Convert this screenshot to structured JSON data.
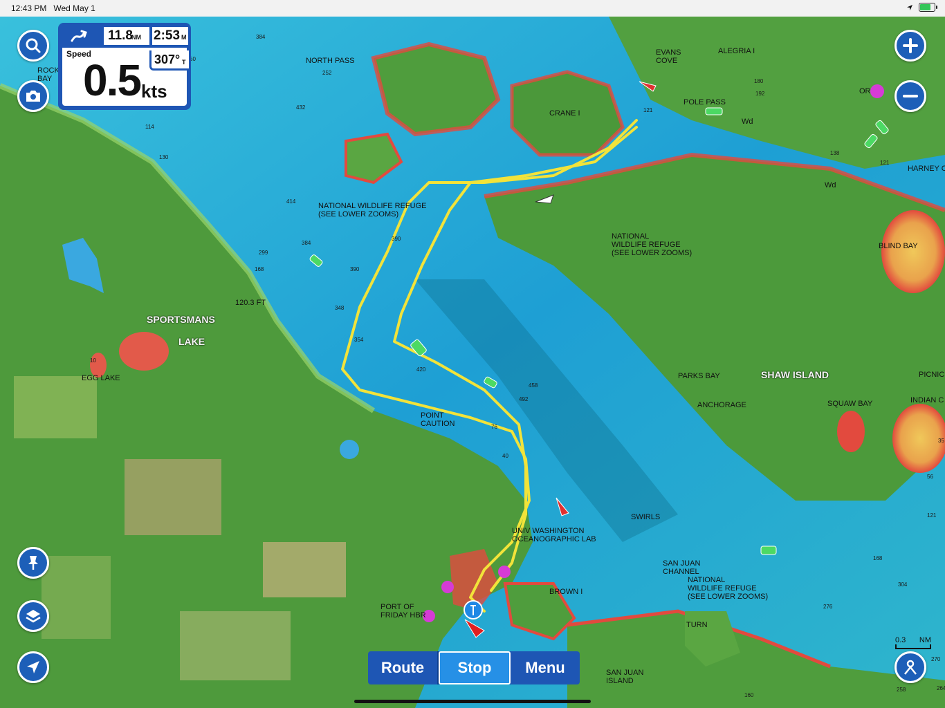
{
  "status_bar": {
    "time": "12:43 PM",
    "date": "Wed May 1"
  },
  "data_panel": {
    "distance_value": "11.8",
    "distance_unit": "NM",
    "eta_value": "2:53",
    "eta_unit": "M",
    "speed_label": "Speed",
    "speed_value": "0.5",
    "speed_unit": "kts",
    "heading_value": "307°",
    "heading_unit": "T"
  },
  "bottom_bar": {
    "route_label": "Route",
    "stop_label": "Stop",
    "menu_label": "Menu"
  },
  "scale": {
    "value": "0.3",
    "unit": "NM"
  },
  "map_labels": {
    "north_pass": "NORTH PASS",
    "evans_cove": "EVANS\nCOVE",
    "alegria": "ALEGRIA I",
    "crane": "CRANE I",
    "pole_pass": "POLE PASS",
    "harney": "HARNEY C",
    "orcas": "OR",
    "rock_bay": "ROCK\nBAY",
    "refuge_1": "NATIONAL WILDLIFE REFUGE\n(SEE LOWER ZOOMS)",
    "refuge_2": "NATIONAL\nWILDLIFE REFUGE\n(SEE LOWER ZOOMS)",
    "refuge_3": "NATIONAL\nWILDLIFE REFUGE\n(SEE LOWER ZOOMS)",
    "blind_bay": "BLIND BAY",
    "sportsmans": "SPORTSMANS",
    "lake": "LAKE",
    "egg_lake": "EGG LAKE",
    "depth_120": "120.3 FT",
    "parks_bay": "PARKS BAY",
    "shaw_island": "SHAW ISLAND",
    "anchorage": "ANCHORAGE",
    "squaw_bay": "SQUAW BAY",
    "picnic": "PICNIC",
    "indian_cove": "INDIAN C",
    "point_caution": "POINT\nCAUTION",
    "washington_lab": "UNIV WASHINGTON\nOCEANOGRAPHIC LAB",
    "swirls": "SWIRLS",
    "san_juan_channel": "SAN JUAN\nCHANNEL",
    "brown_island": "BROWN I",
    "port_of_friday": "PORT OF\nFRIDAY HBR",
    "turn": "TURN",
    "san_juan_island": "SAN JUAN\nISLAND",
    "wd_1": "Wd",
    "wd_2": "Wd"
  },
  "soundings": [
    "252",
    "384",
    "432",
    "414",
    "299",
    "168",
    "384",
    "390",
    "348",
    "354",
    "420",
    "492",
    "458",
    "390",
    "76",
    "40",
    "180",
    "192",
    "121",
    "138",
    "121",
    "56",
    "121",
    "168",
    "276",
    "270",
    "258",
    "304",
    "264",
    "160",
    "35",
    "10",
    "114",
    "130",
    "50"
  ],
  "colors": {
    "panel_blue": "#1e56b4",
    "active_blue": "#2690e6",
    "track_yellow": "#f2e33a",
    "land_green": "#4e9a3c",
    "water_blue": "#2aa8c8",
    "shoal_red": "#e24a3e"
  }
}
